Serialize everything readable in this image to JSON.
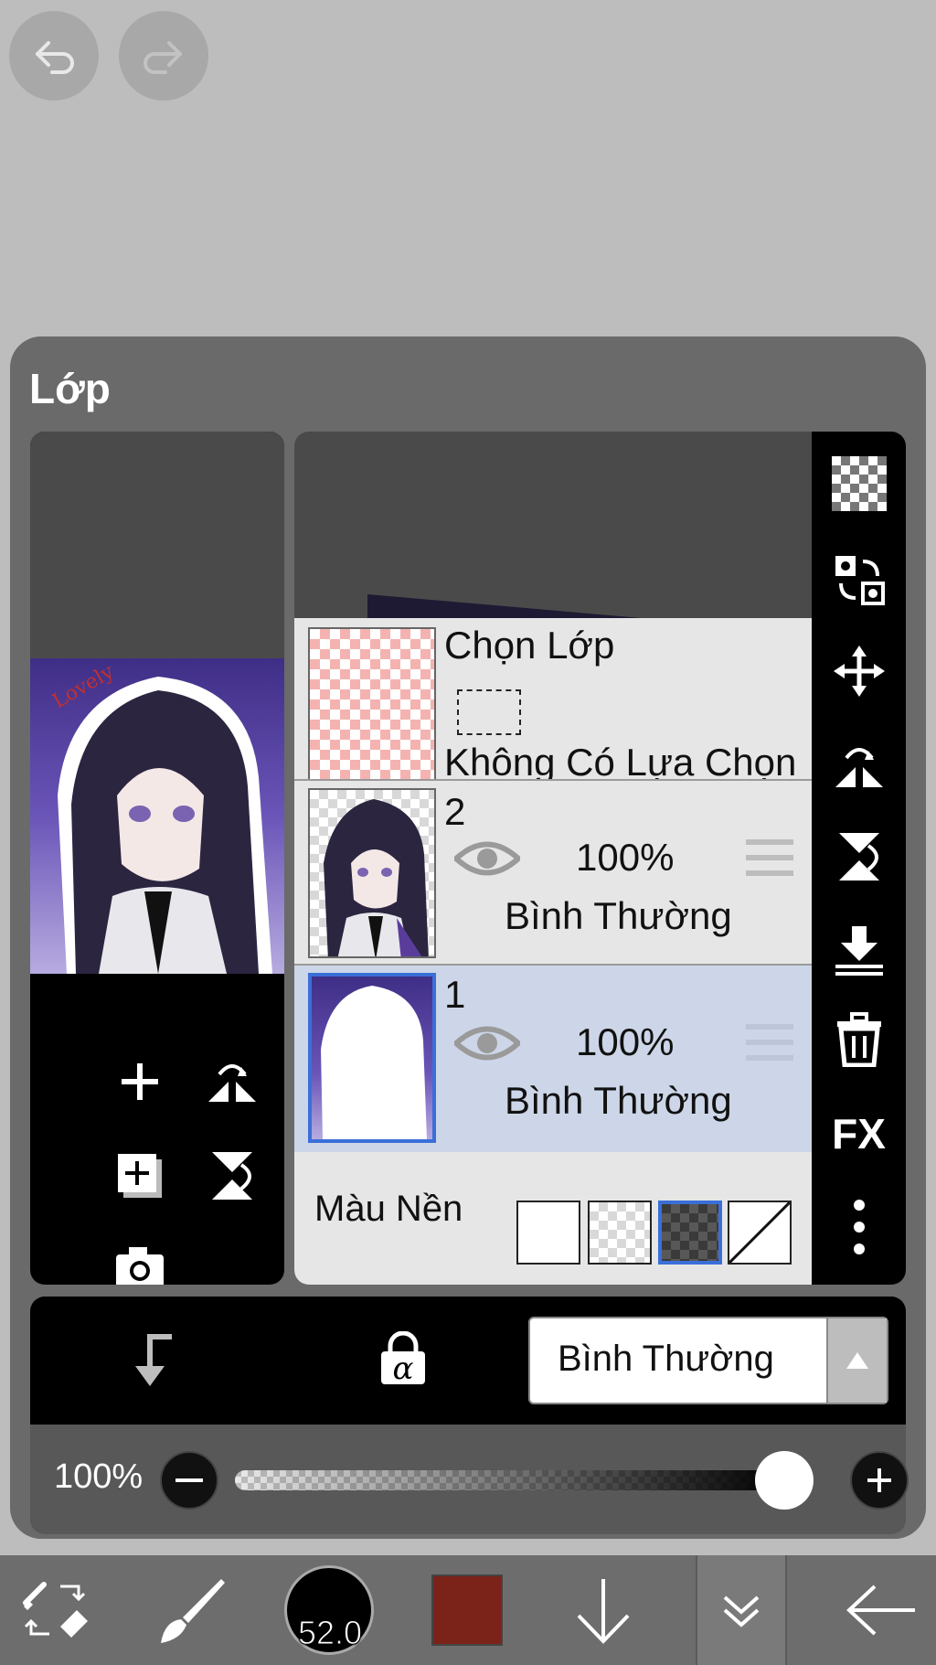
{
  "panel": {
    "title": "Lớp"
  },
  "layers": [
    {
      "type": "selection",
      "title": "Chọn Lớp",
      "subtitle": "Không Có Lựa Chọn"
    },
    {
      "name": "2",
      "opacity": "100%",
      "blend": "Bình Thường",
      "visible": true,
      "selected": false
    },
    {
      "name": "1",
      "opacity": "100%",
      "blend": "Bình Thường",
      "visible": true,
      "selected": true
    }
  ],
  "background": {
    "label": "Màu Nền",
    "options": [
      "white",
      "transparent-light",
      "transparent-dark",
      "none"
    ],
    "selected": "transparent-dark"
  },
  "blend_mode": {
    "value": "Bình Thường"
  },
  "opacity_slider": {
    "label": "100%",
    "value": 1.0
  },
  "right_tools": [
    "checker-icon",
    "swap-layers-icon",
    "move-icon",
    "flip-horizontal-icon",
    "flip-vertical-icon",
    "merge-down-icon",
    "trash-icon",
    "fx-icon",
    "more-icon"
  ],
  "right_tools_fx_label": "FX",
  "brush": {
    "size": "52.0"
  },
  "colors": {
    "current": "#7b2219",
    "accent": "#3a6fd8",
    "selected_row": "#cdd6e8"
  },
  "watermark": "Lovely"
}
